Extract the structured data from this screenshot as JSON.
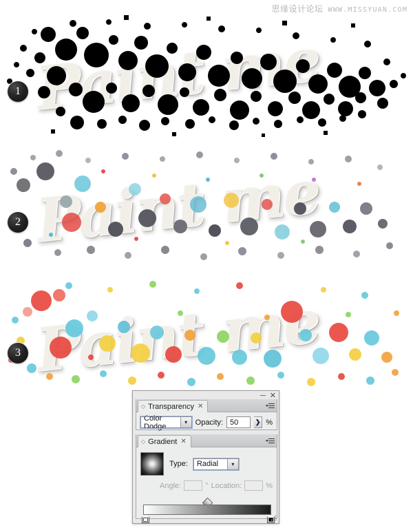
{
  "watermark": {
    "chinese": "思缘设计论坛",
    "url": "WWW.MISSYUAN.COM"
  },
  "steps": [
    {
      "number": "1",
      "name": "step-1",
      "artwork_text": "Paint me",
      "description": "Black splatter layer fully covering the wordmark"
    },
    {
      "number": "2",
      "name": "step-2",
      "artwork_text": "Paint me",
      "description": "Splatters in Color Dodge blend, dark grey and colored specks"
    },
    {
      "number": "3",
      "name": "step-3",
      "artwork_text": "Paint me",
      "description": "Final bright colorful paint splatter result"
    }
  ],
  "panel_group": {
    "window_buttons": {
      "minimize": "─",
      "close": "✕"
    },
    "transparency": {
      "tab_label": "Transparency",
      "tab_close": "✕",
      "grip": "◇",
      "menu_triangle": "◂",
      "blend_mode": "Color Dodge",
      "blend_mode_arrow": "▾",
      "opacity_label": "Opacity:",
      "opacity_value": "50",
      "opacity_stepper_arrow": "❯",
      "percent_symbol": "%"
    },
    "gradient": {
      "tab_label": "Gradient",
      "tab_close": "✕",
      "grip": "◇",
      "menu_triangle": "◂",
      "type_label": "Type:",
      "type_value": "Radial",
      "type_arrow": "▾",
      "angle_label": "Angle:",
      "angle_value": "",
      "degree_symbol": "°",
      "location_label": "Location:",
      "location_value": "",
      "location_percent": "%",
      "ramp_start_color": "#ffffff",
      "ramp_end_color": "#1a1a1a",
      "midpoint_position": "50"
    }
  }
}
